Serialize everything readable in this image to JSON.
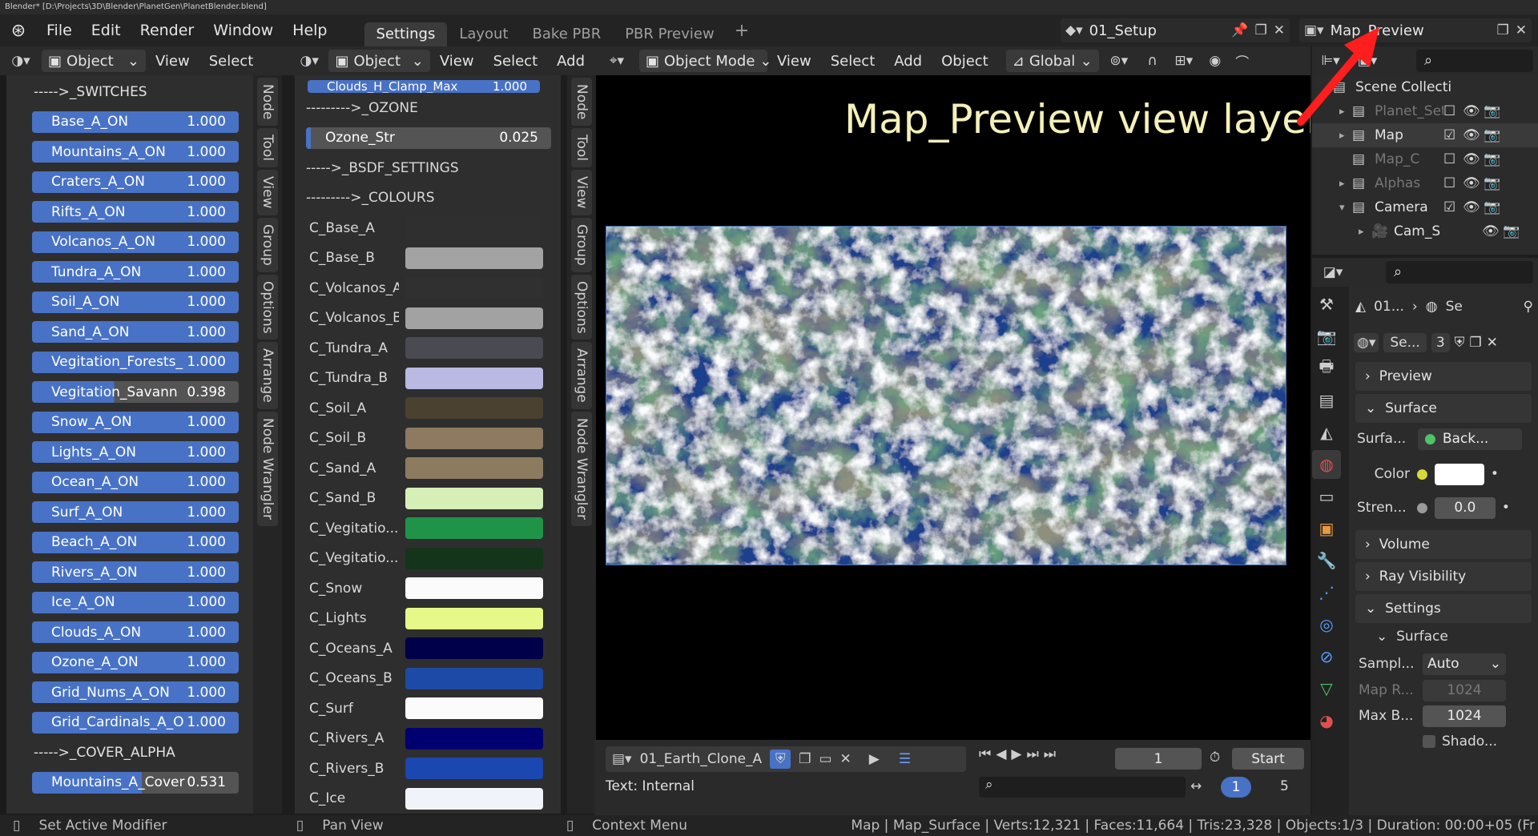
{
  "window_title": "Blender* [D:\\Projects\\3D\\Blender\\PlanetGen\\PlanetBlender.blend]",
  "menu": [
    "File",
    "Edit",
    "Render",
    "Window",
    "Help"
  ],
  "workspaces": [
    {
      "label": "Settings",
      "active": true
    },
    {
      "label": "Layout",
      "active": false
    },
    {
      "label": "Bake PBR",
      "active": false
    },
    {
      "label": "PBR Preview",
      "active": false
    }
  ],
  "scene_name": "01_Setup",
  "view_layer_name": "Map_Preview",
  "left_editor": {
    "mode": "Object",
    "menus": [
      "View",
      "Select"
    ],
    "side_tabs": [
      "Node",
      "Tool",
      "View",
      "Group",
      "Options",
      "Arrange",
      "Node Wrangler"
    ]
  },
  "switches": {
    "section": "----->_SWITCHES",
    "items": [
      {
        "label": "Base_A_ON",
        "value": "1.000"
      },
      {
        "label": "Mountains_A_ON",
        "value": "1.000"
      },
      {
        "label": "Craters_A_ON",
        "value": "1.000"
      },
      {
        "label": "Rifts_A_ON",
        "value": "1.000"
      },
      {
        "label": "Volcanos_A_ON",
        "value": "1.000"
      },
      {
        "label": "Tundra_A_ON",
        "value": "1.000"
      },
      {
        "label": "Soil_A_ON",
        "value": "1.000"
      },
      {
        "label": "Sand_A_ON",
        "value": "1.000"
      },
      {
        "label": "Vegitation_Forests_",
        "value": "1.000"
      },
      {
        "label": "Vegitation_Savann",
        "value": "0.398",
        "fraction": 0.398
      },
      {
        "label": "Snow_A_ON",
        "value": "1.000"
      },
      {
        "label": "Lights_A_ON",
        "value": "1.000"
      },
      {
        "label": "Ocean_A_ON",
        "value": "1.000"
      },
      {
        "label": "Surf_A_ON",
        "value": "1.000"
      },
      {
        "label": "Beach_A_ON",
        "value": "1.000"
      },
      {
        "label": "Rivers_A_ON",
        "value": "1.000"
      },
      {
        "label": "Ice_A_ON",
        "value": "1.000"
      },
      {
        "label": "Clouds_A_ON",
        "value": "1.000"
      },
      {
        "label": "Ozone_A_ON",
        "value": "1.000"
      },
      {
        "label": "Grid_Nums_A_ON",
        "value": "1.000"
      },
      {
        "label": "Grid_Cardinals_A_O",
        "value": "1.000"
      }
    ],
    "cover_section": "----->_COVER_ALPHA",
    "cover_items": [
      {
        "label": "Mountains_A_Cover",
        "value": "0.531",
        "fraction": 0.531
      }
    ]
  },
  "mid_editor": {
    "mode": "Object",
    "menus": [
      "View",
      "Select",
      "Add"
    ],
    "side_tabs": [
      "Node",
      "Tool",
      "View",
      "Group",
      "Options",
      "Arrange",
      "Node Wrangler"
    ],
    "top_slider": {
      "label": "Clouds_H_Clamp_Max",
      "value": "1.000"
    },
    "ozone_section": "--------->_OZONE",
    "ozone_field": {
      "label": "Ozone_Str",
      "value": "0.025"
    },
    "bsdf_section": "----->_BSDF_SETTINGS",
    "colours_section": "--------->_COLOURS",
    "colours": [
      {
        "label": "C_Base_A",
        "color": "#2f2f2f"
      },
      {
        "label": "C_Base_B",
        "color": "#a3a3a3"
      },
      {
        "label": "C_Volcanos_A",
        "color": "#303030"
      },
      {
        "label": "C_Volcanos_B",
        "color": "#a2a2a2"
      },
      {
        "label": "C_Tundra_A",
        "color": "#4a4a52"
      },
      {
        "label": "C_Tundra_B",
        "color": "#b9b9e4"
      },
      {
        "label": "C_Soil_A",
        "color": "#4a4130"
      },
      {
        "label": "C_Soil_B",
        "color": "#8d7a60"
      },
      {
        "label": "C_Sand_A",
        "color": "#8d7b60"
      },
      {
        "label": "C_Sand_B",
        "color": "#d6efb6"
      },
      {
        "label": "C_Vegitatio...",
        "color": "#1f9448"
      },
      {
        "label": "C_Vegitatio...",
        "color": "#15351a"
      },
      {
        "label": "C_Snow",
        "color": "#fbfbfb"
      },
      {
        "label": "C_Lights",
        "color": "#e6f887"
      },
      {
        "label": "C_Oceans_A",
        "color": "#00004a"
      },
      {
        "label": "C_Oceans_B",
        "color": "#1d4aa6"
      },
      {
        "label": "C_Surf",
        "color": "#fbfbfb"
      },
      {
        "label": "C_Rivers_A",
        "color": "#000070"
      },
      {
        "label": "C_Rivers_B",
        "color": "#1a47b0"
      },
      {
        "label": "C_Ice",
        "color": "#f1f3fb"
      }
    ]
  },
  "viewport": {
    "mode": "Object Mode",
    "menus": [
      "View",
      "Select",
      "Add",
      "Object"
    ],
    "transform": "Global",
    "overlay_text": "Map_Preview view layer"
  },
  "image_editor": {
    "image_name": "01_Earth_Clone_A",
    "status": "Text: Internal"
  },
  "timeline": {
    "frame": "1",
    "start_label": "Start",
    "range_a": "1",
    "range_b": "5"
  },
  "outliner": {
    "rows": [
      {
        "label": "Scene Collecti",
        "level": 0,
        "dim": false,
        "checked": null
      },
      {
        "label": "Planet_Set",
        "level": 1,
        "dim": true,
        "checked": false
      },
      {
        "label": "Map",
        "level": 1,
        "dim": false,
        "checked": true
      },
      {
        "label": "Map_C",
        "level": 1,
        "dim": true,
        "checked": false
      },
      {
        "label": "Alphas",
        "level": 1,
        "dim": true,
        "checked": false
      },
      {
        "label": "Camera",
        "level": 1,
        "dim": false,
        "checked": true
      },
      {
        "label": "Cam_S",
        "level": 2,
        "dim": false,
        "checked": null
      }
    ]
  },
  "properties": {
    "breadcrumb_a": "01...",
    "breadcrumb_b": "Se",
    "world_name": "Se...",
    "users": "3",
    "preview": "Preview",
    "surface": "Surface",
    "surface_label": "Surfa...",
    "surface_value": "Back...",
    "color_label": "Color",
    "strength_label": "Stren...",
    "strength_value": "0.0",
    "volume": "Volume",
    "ray_visibility": "Ray Visibility",
    "settings": "Settings",
    "settings_surface": "Surface",
    "sampling_label": "Sampl...",
    "sampling_value": "Auto",
    "map_res_label": "Map R...",
    "map_res_value": "1024",
    "max_bounces_label": "Max B...",
    "max_bounces_value": "1024",
    "shadow_label": "Shado..."
  },
  "status": {
    "left": "Set Active Modifier",
    "mid": "Pan View",
    "right": "Context Menu",
    "stats": "Map | Map_Surface | Verts:12,321 | Faces:11,664 | Tris:23,328 | Objects:1/3 | Duration: 00:00+05 (Fr"
  }
}
